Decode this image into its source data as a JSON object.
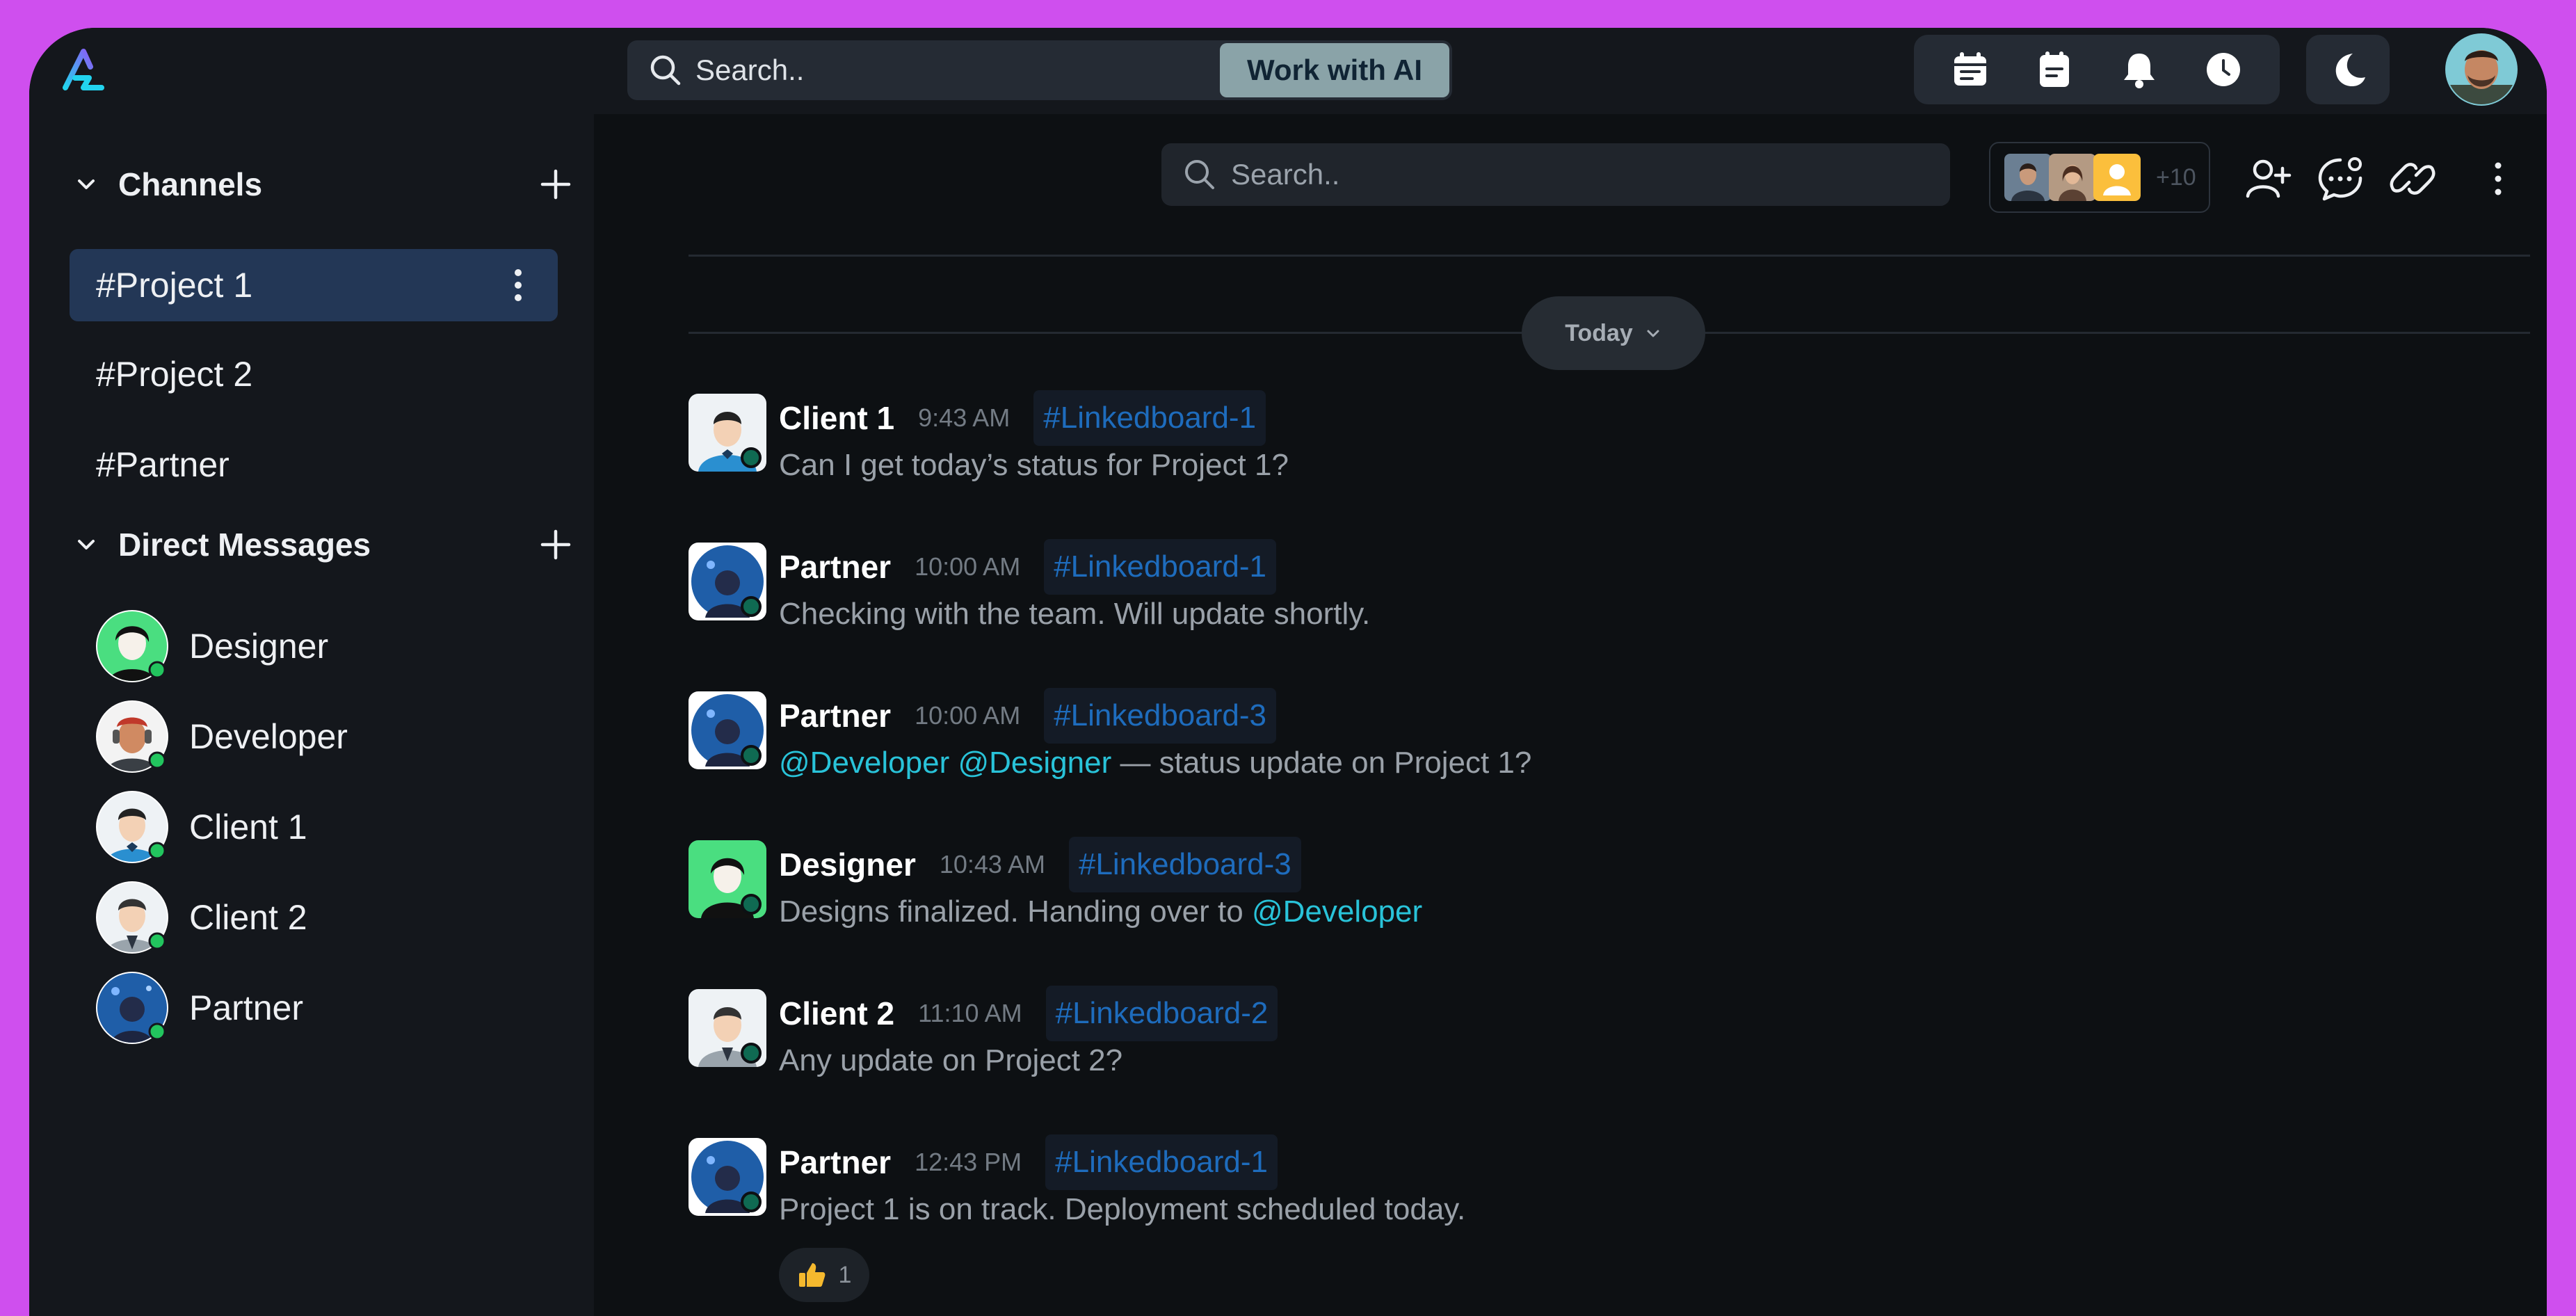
{
  "topbar": {
    "search_placeholder": "Search..",
    "ai_button": "Work with AI",
    "tools": [
      "calendar-icon",
      "notes-icon",
      "bell-icon",
      "clock-icon"
    ],
    "theme_icon": "moon-icon"
  },
  "sidebar": {
    "channels_title": "Channels",
    "channels": [
      {
        "label": "#Project 1",
        "active": true
      },
      {
        "label": "#Project 2",
        "active": false
      },
      {
        "label": "#Partner",
        "active": false
      }
    ],
    "dm_title": "Direct Messages",
    "dms": [
      {
        "label": "Designer",
        "status": "online"
      },
      {
        "label": "Developer",
        "status": "online"
      },
      {
        "label": "Client 1",
        "status": "online"
      },
      {
        "label": "Client 2",
        "status": "online"
      },
      {
        "label": "Partner",
        "status": "online"
      }
    ]
  },
  "channel": {
    "search_placeholder": "Search..",
    "members_more": "+10",
    "date_divider": "Today"
  },
  "messages": [
    {
      "name": "Client 1",
      "time": "9:43 AM",
      "tag": "#Linkedboard-1",
      "text": "Can I get today’s status for Project 1?"
    },
    {
      "name": "Partner",
      "time": "10:00 AM",
      "tag": "#Linkedboard-1",
      "text": "Checking with the team. Will update shortly."
    },
    {
      "name": "Partner",
      "time": "10:00 AM",
      "tag": "#Linkedboard-3",
      "mention1": "@Developer",
      "mention2": "@Designer",
      "text": " — status update on Project 1?"
    },
    {
      "name": "Designer",
      "time": "10:43 AM",
      "tag": "#Linkedboard-3",
      "text": "Designs finalized. Handing over to ",
      "mention": "@Developer"
    },
    {
      "name": "Client 2",
      "time": "11:10 AM",
      "tag": "#Linkedboard-2",
      "text": "Any update on Project 2?"
    },
    {
      "name": "Partner",
      "time": "12:43 PM",
      "tag": "#Linkedboard-1",
      "text": "Project 1 is on track. Deployment scheduled today.",
      "reaction_count": "1"
    }
  ],
  "colors": {
    "accent": "#cf4fee",
    "active_channel": "#233756",
    "tag": "#1e6cbd",
    "mention": "#29c3d9",
    "online": "#22c55e"
  }
}
